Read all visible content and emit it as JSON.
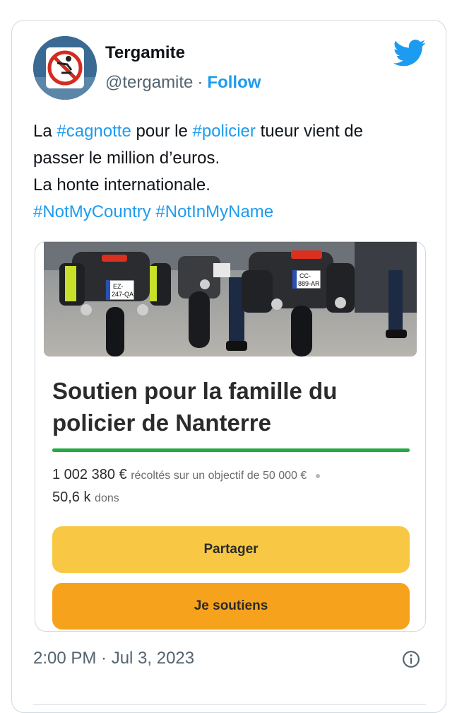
{
  "author": {
    "name": "Tergamite",
    "handle": "@tergamite",
    "separator": "·",
    "follow_label": "Follow"
  },
  "tweet": {
    "lines": [
      [
        {
          "t": "La "
        },
        {
          "t": "#cagnotte",
          "tag": true
        },
        {
          "t": " pour le "
        },
        {
          "t": "#policier",
          "tag": true
        },
        {
          "t": " tueur vient de"
        }
      ],
      [
        {
          "t": "passer le million d’euros."
        }
      ],
      [
        {
          "t": "La honte internationale."
        }
      ],
      [
        {
          "t": "#NotMyCountry",
          "tag": true
        },
        {
          "t": " "
        },
        {
          "t": "#NotInMyName",
          "tag": true
        }
      ]
    ]
  },
  "embed": {
    "photo": {
      "plate_left": "EZ-\n247-QA",
      "plate_right": "CC-\n889-AR"
    },
    "title": "Soutien pour la famille du policier de Nanterre",
    "amount": "1 002 380 €",
    "goal_text": "récoltés sur un objectif de 50 000 €",
    "bullet": "●",
    "donations_count": "50,6 k",
    "donations_label": "dons",
    "progress_fraction": 1.0,
    "share_label": "Partager",
    "support_label": "Je soutiens"
  },
  "footer": {
    "timestamp": "2:00 PM · Jul 3, 2023"
  },
  "colors": {
    "link_blue": "#1d9bf0",
    "progress_green": "#27a843",
    "share_yellow": "#f8c844",
    "support_orange": "#f7a21c"
  },
  "icons": {
    "brand": "twitter-bird-icon",
    "info": "info-icon",
    "avatar": "no-diving-sign-avatar"
  }
}
